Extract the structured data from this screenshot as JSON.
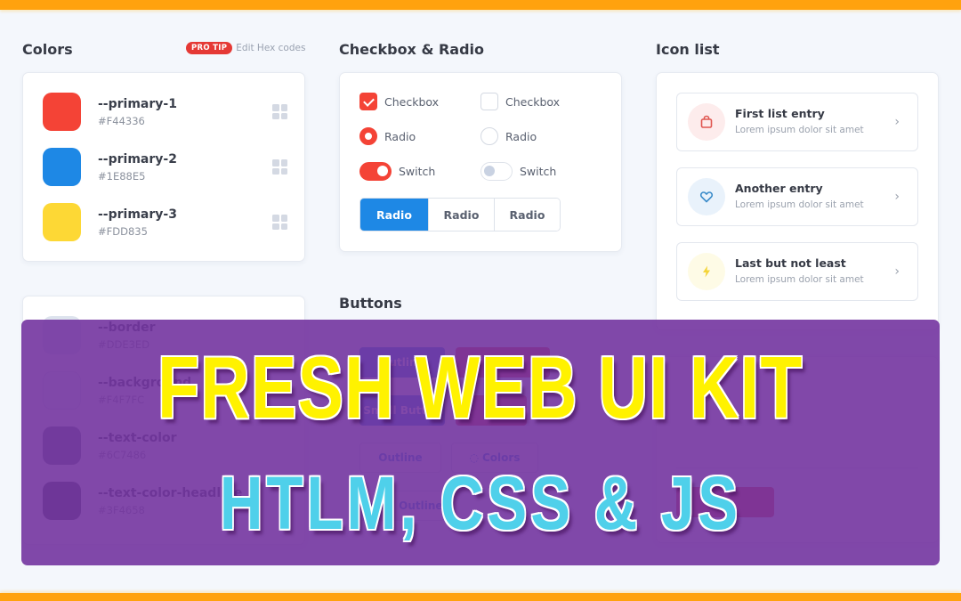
{
  "colors_section": {
    "title": "Colors",
    "pro_tip_badge": "PRO TIP",
    "pro_tip_text": "Edit Hex codes",
    "primary": [
      {
        "name": "--primary-1",
        "hex": "#F44336",
        "color": "#F44336"
      },
      {
        "name": "--primary-2",
        "hex": "#1E88E5",
        "color": "#1E88E5"
      },
      {
        "name": "--primary-3",
        "hex": "#FDD835",
        "color": "#FDD835"
      }
    ],
    "secondary": [
      {
        "name": "--border",
        "hex": "#DDE3ED",
        "color": "#DDE3ED"
      },
      {
        "name": "--background",
        "hex": "#F4F7FC",
        "color": "#F4F7FC"
      },
      {
        "name": "--text-color",
        "hex": "#6C7486",
        "color": "#6C7486"
      },
      {
        "name": "--text-color-headline",
        "hex": "#3F4658",
        "color": "#3F4658"
      }
    ]
  },
  "checkbox_section": {
    "title": "Checkbox & Radio",
    "checkbox_on": "Checkbox",
    "checkbox_off": "Checkbox",
    "radio_on": "Radio",
    "radio_off": "Radio",
    "switch_on": "Switch",
    "switch_off": "Switch",
    "segments": [
      "Radio",
      "Radio",
      "Radio"
    ],
    "active_segment": 0
  },
  "buttons_section": {
    "title": "Buttons",
    "buttons": [
      "Outline",
      "Colors",
      "Small Button",
      "Small Outline"
    ]
  },
  "icon_list": {
    "title": "Icon list",
    "entries": [
      {
        "title": "First list entry",
        "subtitle": "Lorem ipsum dolor sit amet",
        "icon": "shopping-bag-icon",
        "accent": "#F44336"
      },
      {
        "title": "Another entry",
        "subtitle": "Lorem ipsum dolor sit amet",
        "icon": "heart-icon",
        "accent": "#1E88E5"
      },
      {
        "title": "Last but not least",
        "subtitle": "Lorem ipsum dolor sit amet",
        "icon": "lightning-icon",
        "accent": "#FDD835"
      }
    ]
  },
  "banner": {
    "line1": "FRESH WEB UI KIT",
    "line2": "HTLM, CSS & JS"
  },
  "theme": {
    "accent_bar": "#FFA20E",
    "overlay": "#7E3FAE"
  }
}
